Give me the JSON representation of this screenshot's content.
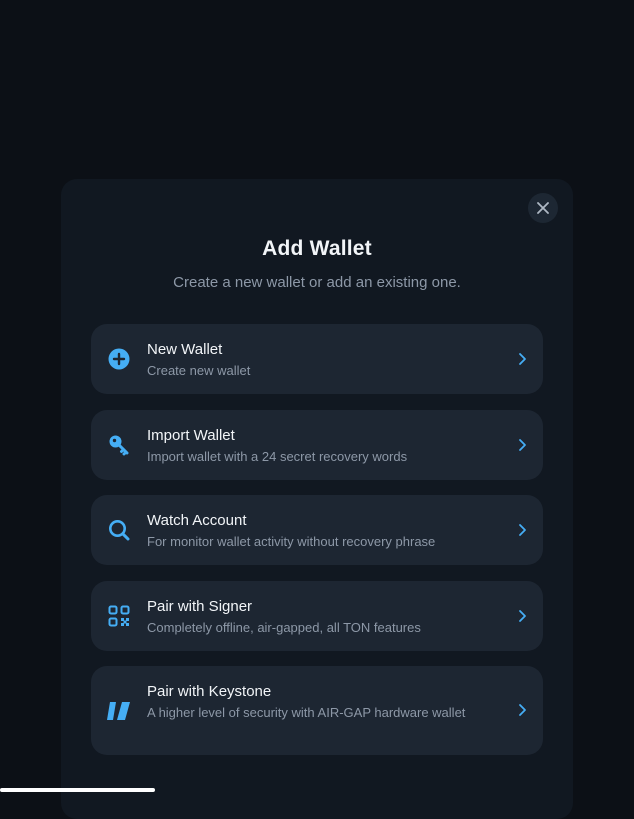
{
  "modal": {
    "title": "Add Wallet",
    "subtitle": "Create a new wallet or add an existing one.",
    "close_icon": "close-icon"
  },
  "options": [
    {
      "label": "New Wallet",
      "description": "Create new wallet",
      "icon": "plus-circle-icon"
    },
    {
      "label": "Import Wallet",
      "description": "Import wallet with a 24 secret recovery words",
      "icon": "key-icon"
    },
    {
      "label": "Watch Account",
      "description": "For monitor wallet activity without recovery phrase",
      "icon": "magnifier-icon"
    },
    {
      "label": "Pair with Signer",
      "description": "Completely offline, air-gapped, all TON features",
      "icon": "qr-code-icon"
    },
    {
      "label": "Pair with Keystone",
      "description": "A higher level of security with AIR-GAP hardware wallet",
      "icon": "keystone-icon"
    }
  ],
  "colors": {
    "background": "#0c1016",
    "modal": "#111821",
    "card": "#1d2632",
    "accent": "#45aef5",
    "text_primary": "#f2f5f8",
    "text_secondary": "#8d98a7"
  }
}
